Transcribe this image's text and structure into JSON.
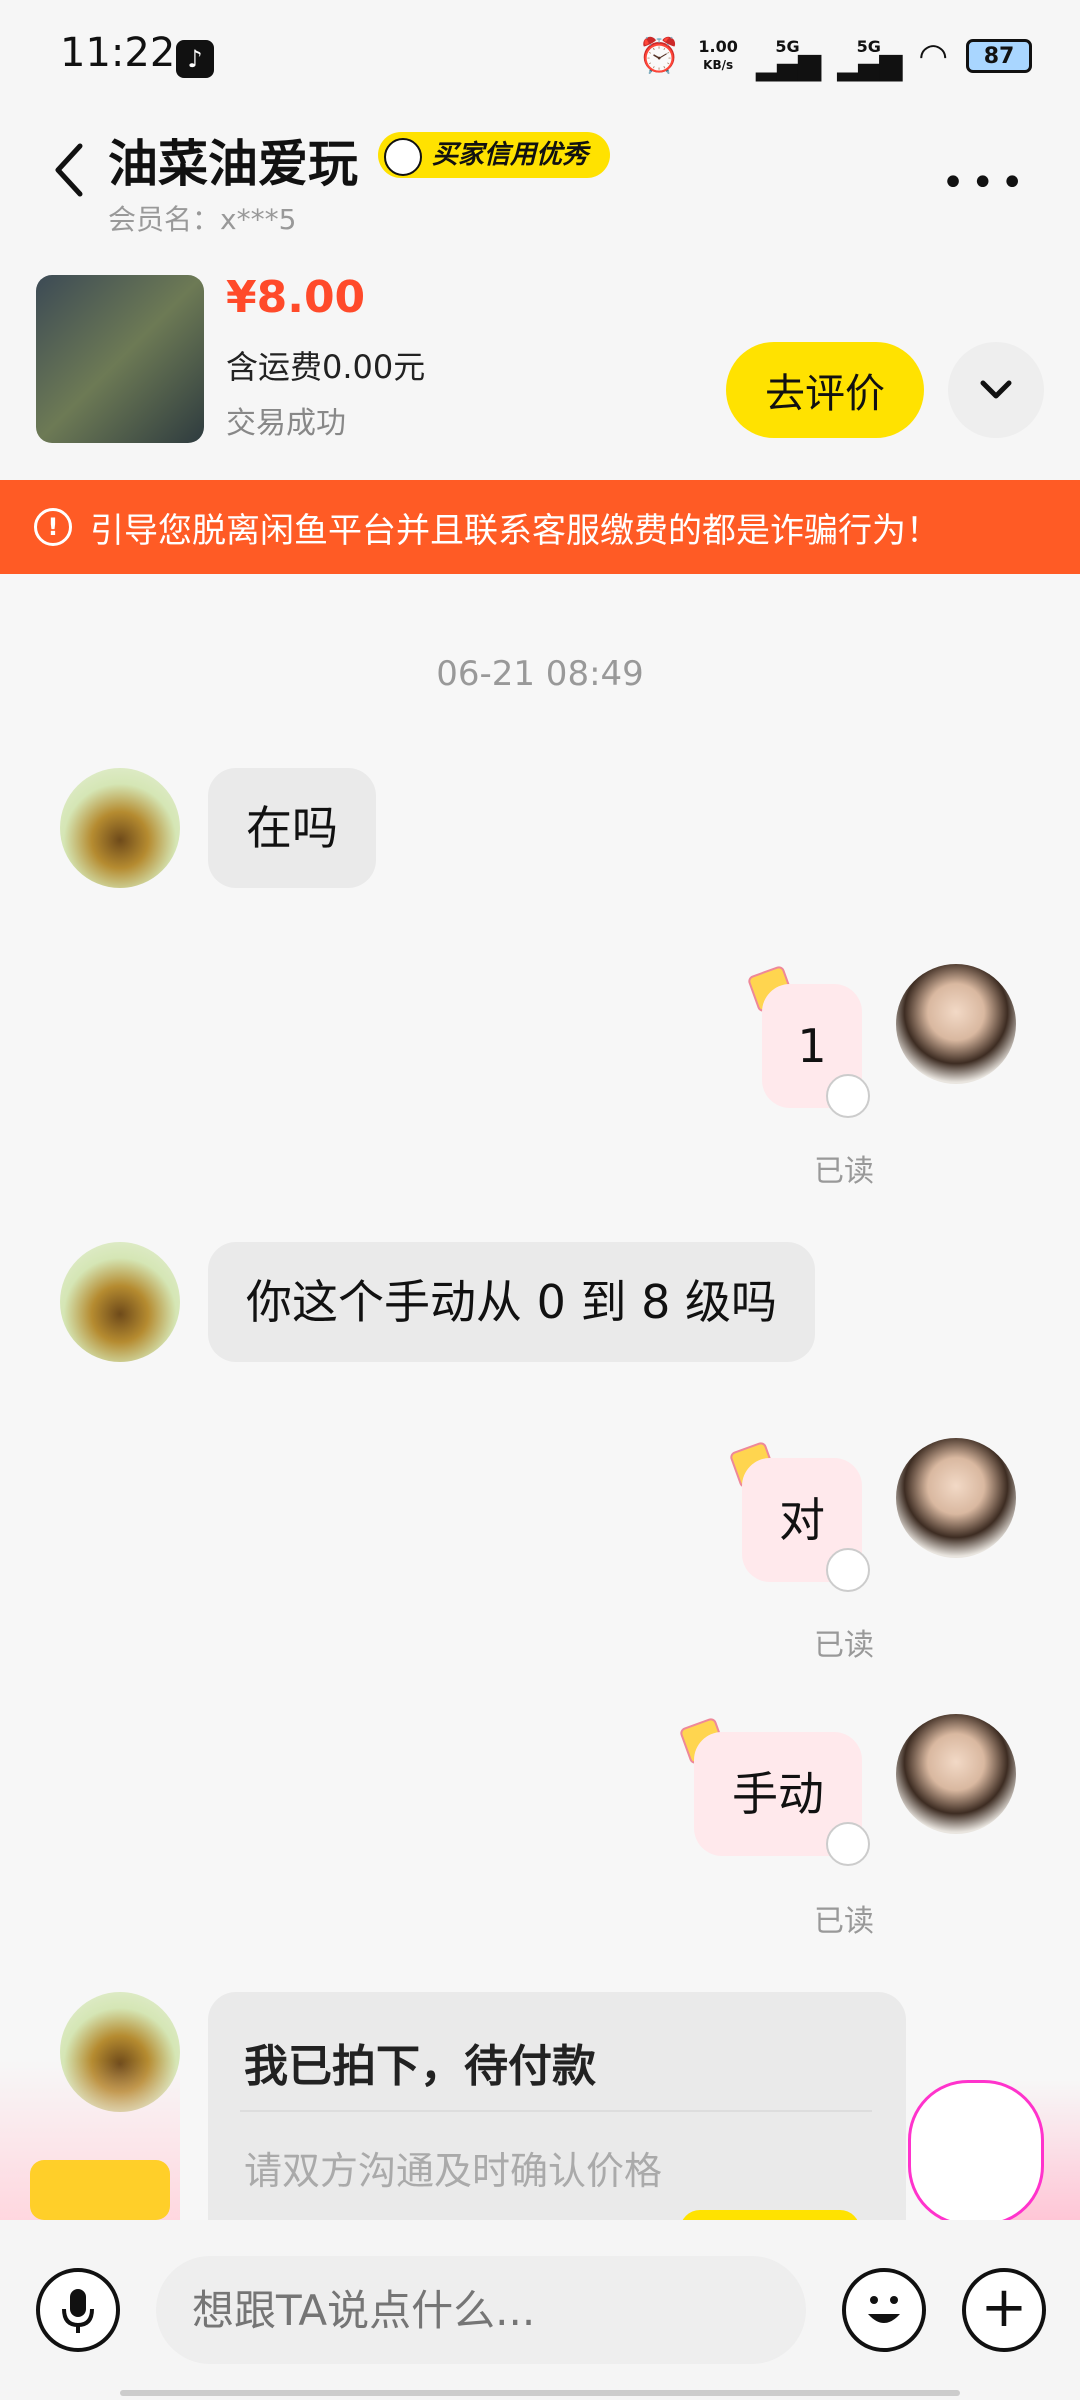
{
  "status_bar": {
    "time": "11:22",
    "speed": "1.00",
    "speed_unit": "KB/s",
    "net1": "5G",
    "net2": "5G",
    "battery": "87"
  },
  "header": {
    "name": "油菜油爱玩",
    "badge": "买家信用优秀",
    "member": "会员名：x***5"
  },
  "product": {
    "price": "¥8.00",
    "shipping": "含运费0.00元",
    "status": "交易成功",
    "review_button": "去评价"
  },
  "warning": {
    "text": "引导您脱离闲鱼平台并且联系客服缴费的都是诈骗行为！"
  },
  "chat": {
    "timestamp": "06-21 08:49",
    "messages": [
      {
        "side": "left",
        "text": "在吗"
      },
      {
        "side": "right",
        "text": "1",
        "status": "已读"
      },
      {
        "side": "left",
        "text": "你这个手动从 0 到 8 级吗"
      },
      {
        "side": "right",
        "text": "对",
        "status": "已读"
      },
      {
        "side": "right",
        "text": "手动",
        "status": "已读"
      }
    ],
    "card": {
      "title": "我已拍下，待付款",
      "subtitle": "请双方沟通及时确认价格"
    }
  },
  "input": {
    "placeholder": "想跟TA说点什么..."
  },
  "colors": {
    "accent_yellow": "#ffe200",
    "warning_orange": "#ff5b25",
    "price_red": "#ff4a2a",
    "bubble_right": "#ffe9ec"
  }
}
